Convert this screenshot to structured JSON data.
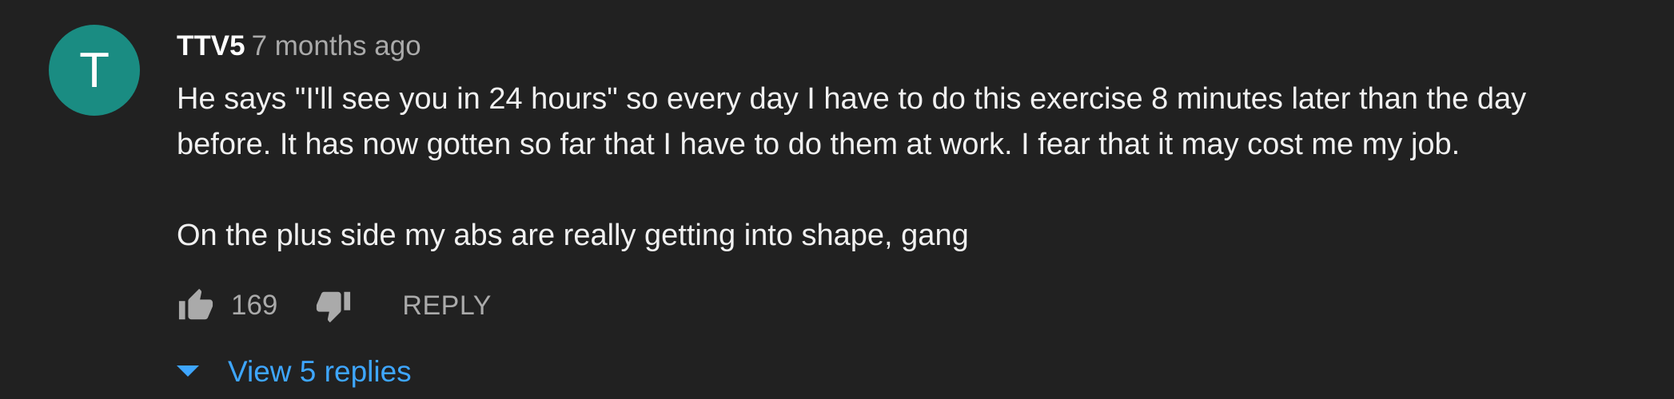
{
  "comment": {
    "avatar_letter": "T",
    "avatar_color": "#1a8c82",
    "author": "TTV5",
    "timestamp": "7 months ago",
    "text_line_1": "He says \"I'll see you in 24 hours\" so every day I have to do this exercise 8 minutes later than the day",
    "text_line_2": "before. It has now gotten so far that I have to do them at work. I fear that it may cost me my job.",
    "text_line_3": "On the plus side my abs are really getting into shape, gang",
    "like_count": "169",
    "reply_label": "REPLY",
    "view_replies_label": "View 5 replies"
  },
  "icons": {
    "like": "thumbs-up-icon",
    "dislike": "thumbs-down-icon",
    "expand": "caret-down-icon"
  },
  "colors": {
    "background": "#212121",
    "link": "#3ea6ff",
    "secondary_text": "#aaaaaa"
  }
}
